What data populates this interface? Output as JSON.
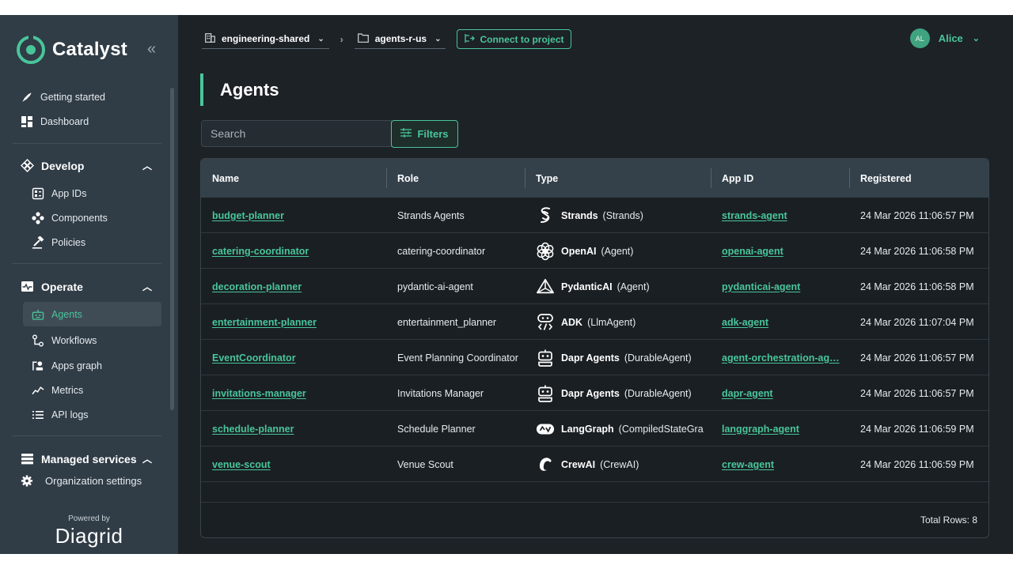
{
  "brand": {
    "name": "Catalyst",
    "collapse_icon": "double-chevron-left-icon"
  },
  "sidebar": {
    "top_items": [
      {
        "label": "Getting started",
        "icon": "rocket-icon"
      },
      {
        "label": "Dashboard",
        "icon": "dashboard-icon"
      }
    ],
    "develop": {
      "label": "Develop",
      "items": [
        {
          "label": "App IDs",
          "icon": "app-id-icon"
        },
        {
          "label": "Components",
          "icon": "components-icon"
        },
        {
          "label": "Policies",
          "icon": "policies-icon"
        }
      ]
    },
    "operate": {
      "label": "Operate",
      "items": [
        {
          "label": "Agents",
          "icon": "robot-icon",
          "active": true
        },
        {
          "label": "Workflows",
          "icon": "workflow-icon"
        },
        {
          "label": "Apps graph",
          "icon": "graph-icon"
        },
        {
          "label": "Metrics",
          "icon": "metrics-icon"
        },
        {
          "label": "API logs",
          "icon": "list-icon"
        }
      ]
    },
    "managed_services": {
      "label": "Managed services"
    },
    "org_settings": {
      "label": "Organization settings"
    },
    "powered_by": "Powered by",
    "powered_brand": "Diagrid"
  },
  "header": {
    "org": "engineering-shared",
    "project": "agents-r-us",
    "connect_label": "Connect to project",
    "user_initials": "AL",
    "user_name": "Alice"
  },
  "page": {
    "title": "Agents",
    "search_placeholder": "Search",
    "filters_label": "Filters"
  },
  "table": {
    "columns": [
      "Name",
      "Role",
      "Type",
      "App ID",
      "Registered"
    ],
    "rows": [
      {
        "name": "budget-planner",
        "role": "Strands Agents",
        "type_icon": "strands-icon",
        "type_name": "Strands",
        "type_class": "(Strands)",
        "app_id": "strands-agent",
        "registered": "24 Mar 2026 11:06:57 PM"
      },
      {
        "name": "catering-coordinator",
        "role": "catering-coordinator",
        "type_icon": "openai-icon",
        "type_name": "OpenAI",
        "type_class": "(Agent)",
        "app_id": "openai-agent",
        "registered": "24 Mar 2026 11:06:58 PM"
      },
      {
        "name": "decoration-planner",
        "role": "pydantic-ai-agent",
        "type_icon": "pydanticai-icon",
        "type_name": "PydanticAI",
        "type_class": "(Agent)",
        "app_id": "pydanticai-agent",
        "registered": "24 Mar 2026 11:06:58 PM"
      },
      {
        "name": "entertainment-planner",
        "role": "entertainment_planner",
        "type_icon": "adk-icon",
        "type_name": "ADK",
        "type_class": "(LlmAgent)",
        "app_id": "adk-agent",
        "registered": "24 Mar 2026 11:07:04 PM"
      },
      {
        "name": "EventCoordinator",
        "role": "Event Planning Coordinator",
        "type_icon": "dapr-agents-icon",
        "type_name": "Dapr Agents",
        "type_class": "(DurableAgent)",
        "app_id": "agent-orchestration-ag…",
        "registered": "24 Mar 2026 11:06:57 PM"
      },
      {
        "name": "invitations-manager",
        "role": "Invitations Manager",
        "type_icon": "dapr-agents-icon",
        "type_name": "Dapr Agents",
        "type_class": "(DurableAgent)",
        "app_id": "dapr-agent",
        "registered": "24 Mar 2026 11:06:57 PM"
      },
      {
        "name": "schedule-planner",
        "role": "Schedule Planner",
        "type_icon": "langgraph-icon",
        "type_name": "LangGraph",
        "type_class": "(CompiledStateGra",
        "app_id": "langgraph-agent",
        "registered": "24 Mar 2026 11:06:59 PM"
      },
      {
        "name": "venue-scout",
        "role": "Venue Scout",
        "type_icon": "crewai-icon",
        "type_name": "CrewAI",
        "type_class": "(CrewAI)",
        "app_id": "crew-agent",
        "registered": "24 Mar 2026 11:06:59 PM"
      }
    ],
    "total_rows": "Total Rows: 8"
  },
  "colors": {
    "accent": "#49c59a",
    "sidebar": "#303c46",
    "background": "#1d2227",
    "header_row": "#34414b"
  }
}
